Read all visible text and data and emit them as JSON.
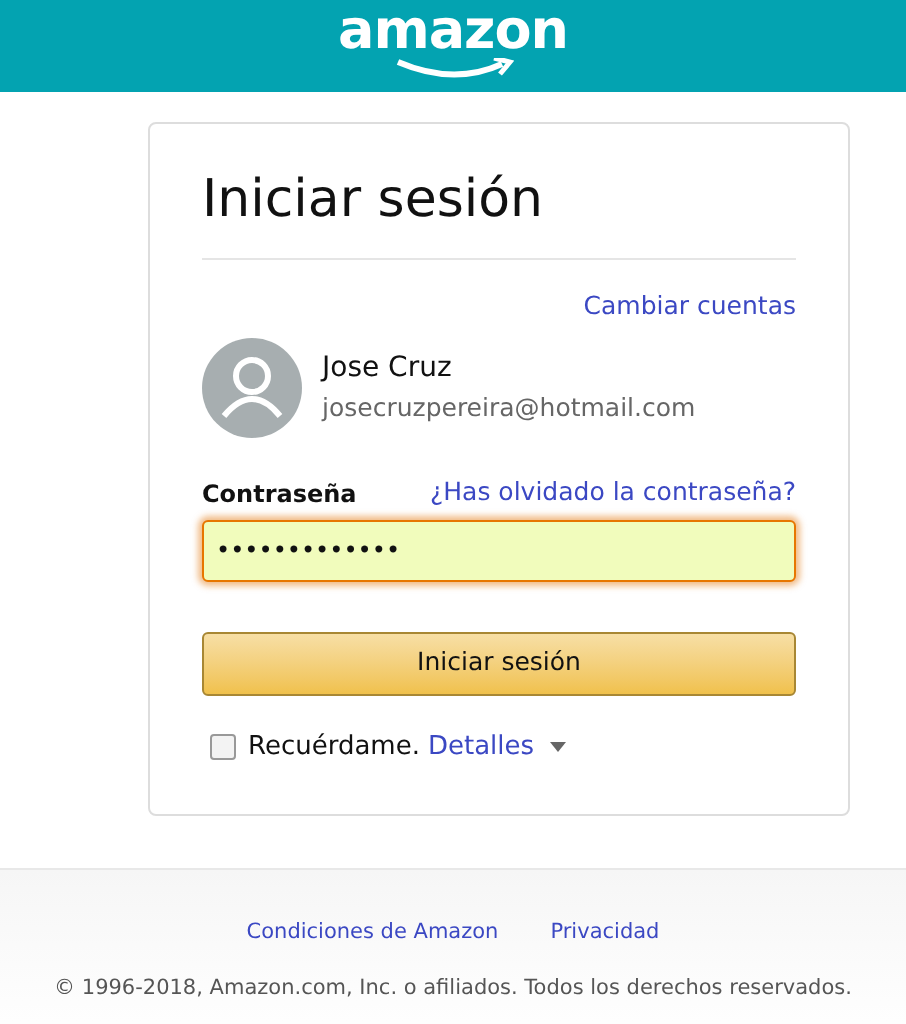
{
  "header": {
    "logo": "amazon"
  },
  "signin": {
    "title": "Iniciar sesión",
    "switch_account": "Cambiar cuentas",
    "account": {
      "name": "Jose Cruz",
      "email": "josecruzpereira@hotmail.com"
    },
    "password": {
      "label": "Contraseña",
      "forgot": "¿Has olvidado la contraseña?",
      "value": "•••••••••••••"
    },
    "submit": "Iniciar sesión",
    "remember": {
      "label": "Recuérdame.",
      "checked": false,
      "details": "Detalles"
    }
  },
  "footer": {
    "links": [
      "Condiciones de Amazon",
      "Privacidad"
    ],
    "copyright": "© 1996-2018, Amazon.com, Inc. o afiliados. Todos los derechos reservados."
  }
}
